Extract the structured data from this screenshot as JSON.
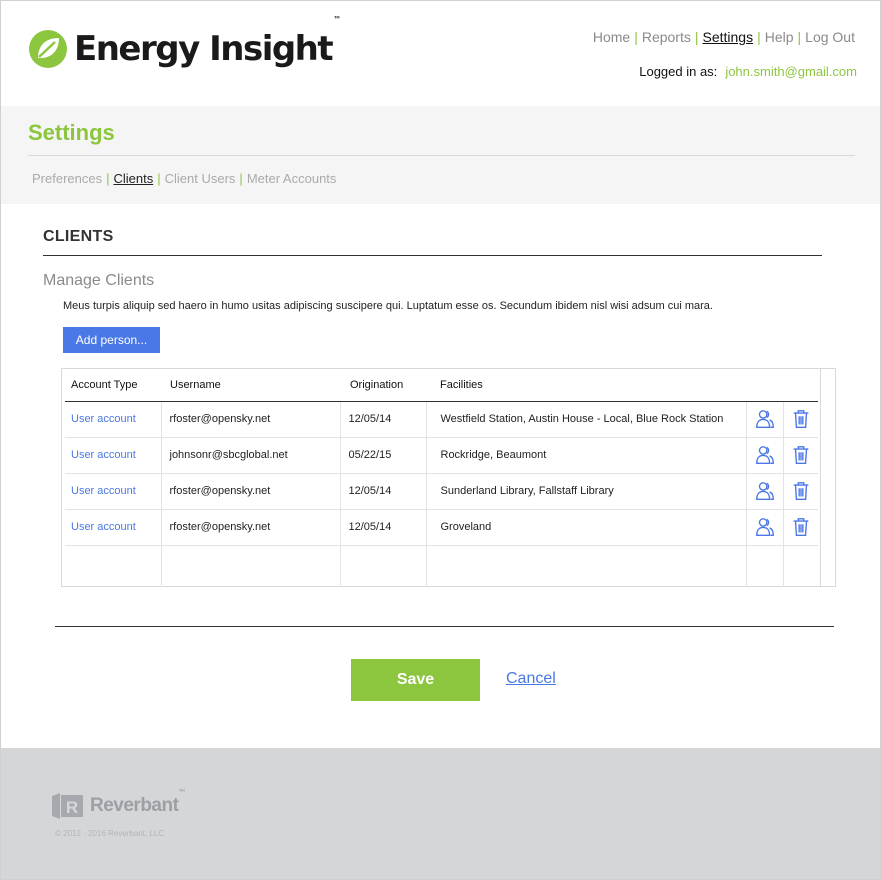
{
  "header": {
    "app_title": "Energy Insight",
    "trademark": "™",
    "nav": [
      {
        "label": "Home",
        "active": false
      },
      {
        "label": "Reports",
        "active": false
      },
      {
        "label": "Settings",
        "active": true
      },
      {
        "label": "Help",
        "active": false
      },
      {
        "label": "Log Out",
        "active": false
      }
    ],
    "logged_in_label": "Logged in as:",
    "user_email": "john.smith@gmail.com"
  },
  "settings": {
    "title": "Settings",
    "tabs": [
      {
        "label": "Preferences",
        "active": false
      },
      {
        "label": "Clients",
        "active": true
      },
      {
        "label": "Client Users",
        "active": false
      },
      {
        "label": "Meter Accounts",
        "active": false
      }
    ]
  },
  "clients": {
    "section_title": "CLIENTS",
    "manage_title": "Manage Clients",
    "description": "Meus turpis aliquip sed haero in humo usitas adipiscing suscipere qui. Luptatum esse os. Secundum ibidem nisl wisi adsum cui mara.",
    "add_button": "Add person...",
    "columns": [
      "Account Type",
      "Username",
      "Origination",
      "Facilities"
    ],
    "rows": [
      {
        "account_type": "User account",
        "username": "rfoster@opensky.net",
        "origination": "12/05/14",
        "facilities": "Westfield Station, Austin House - Local, Blue Rock Station"
      },
      {
        "account_type": "User account",
        "username": "johnsonr@sbcglobal.net",
        "origination": "05/22/15",
        "facilities": "Rockridge, Beaumont"
      },
      {
        "account_type": "User account",
        "username": "rfoster@opensky.net",
        "origination": "12/05/14",
        "facilities": "Sunderland Library, Fallstaff Library"
      },
      {
        "account_type": "User account",
        "username": "rfoster@opensky.net",
        "origination": "12/05/14",
        "facilities": "Groveland"
      }
    ],
    "row_icons": [
      "users-icon",
      "trash-icon"
    ]
  },
  "actions": {
    "save": "Save",
    "cancel": "Cancel"
  },
  "footer": {
    "brand": "Reverbant",
    "brand_tm": "™",
    "copyright": "© 2012 - 2016 Reverbant, LLC"
  },
  "colors": {
    "brand_green": "#8cc63f",
    "link_blue": "#4a78e6",
    "footer_bg": "#d5d6d8"
  }
}
